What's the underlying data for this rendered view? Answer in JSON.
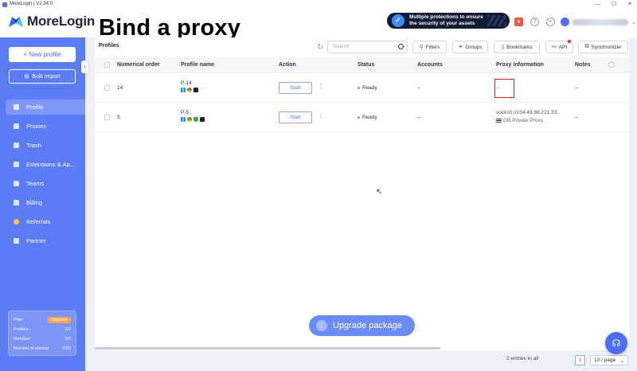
{
  "window": {
    "title": "MoreLogin | V2.34.0"
  },
  "brand": {
    "name": "MoreLogin"
  },
  "heading": "Bind a proxy",
  "promo": {
    "line1": "Multiple protections to ensure",
    "line2": "the security of your assets"
  },
  "sidebar": {
    "new_profile": "+ New profile",
    "bulk_import": "Bulk import",
    "items": [
      {
        "label": "Profile",
        "active": true
      },
      {
        "label": "Proxies"
      },
      {
        "label": "Trash"
      },
      {
        "label": "Extensions & Ap..."
      },
      {
        "label": "Teams"
      },
      {
        "label": "Billing"
      },
      {
        "label": "Referrals"
      },
      {
        "label": "Partner"
      }
    ],
    "plan": {
      "plan_label": "Plan",
      "upgrade": "Upgrade",
      "profiles_label": "Profiles:",
      "profiles_value": "2/2",
      "member_label": "Member:",
      "member_value": "1/2",
      "startup_label": "Number of startup:",
      "startup_value": "2/20"
    }
  },
  "main": {
    "title": "Profiles",
    "search_placeholder": "Search",
    "filters": "Filters",
    "groups": "Groups",
    "bookmarks": "Bookmarks",
    "api": "API",
    "synchronizer": "Synchronizer"
  },
  "table": {
    "headers": {
      "order": "Numerical order",
      "name": "Profile name",
      "action": "Action",
      "status": "Status",
      "accounts": "Accounts",
      "proxy": "Proxy information",
      "notes": "Notes"
    },
    "rows": [
      {
        "order": "14",
        "name": "P-14",
        "action": "Start",
        "status": "Ready",
        "accounts": "--",
        "proxy": "--",
        "proxy_type": "",
        "notes": "--"
      },
      {
        "order": "5",
        "name": "P-5",
        "action": "Start",
        "status": "Ready",
        "accounts": "--",
        "proxy": "socks5://154.49.98.221:33...",
        "proxy_type": "GB,Private Proxy",
        "notes": "--"
      }
    ]
  },
  "footer": {
    "upgrade_package": "Upgrade package",
    "entries": "2 entries in all",
    "page": "1",
    "per_page": "10 / page"
  }
}
